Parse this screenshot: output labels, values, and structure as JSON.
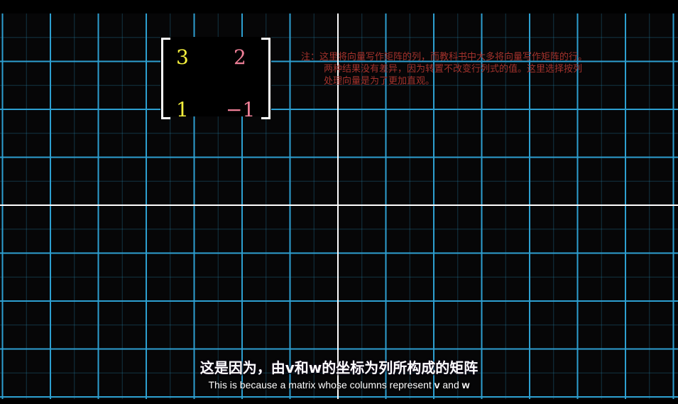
{
  "matrix": {
    "a11": "3",
    "a12": "2",
    "a21": "1",
    "a22": "−1",
    "col_v_color": "#f4ef3c",
    "col_w_color": "#ef7f97"
  },
  "note": {
    "line1": "注：这里将向量写作矩阵的列，而教科书中大多将向量写作矩阵的行。",
    "line2": "两种结果没有差异，因为转置不改变行列式的值。这里选择按列",
    "line3": "处理向量是为了更加直观。",
    "color": "#a3322c"
  },
  "subtitles": {
    "chinese": "这是因为，由v和w的坐标为列所构成的矩阵",
    "english_prefix": "This is because a matrix whose columns represent ",
    "english_v": "v",
    "english_and": " and ",
    "english_w": "w"
  },
  "grid": {
    "line_color": "#2d9fd0",
    "axis_color": "#ffffff"
  }
}
